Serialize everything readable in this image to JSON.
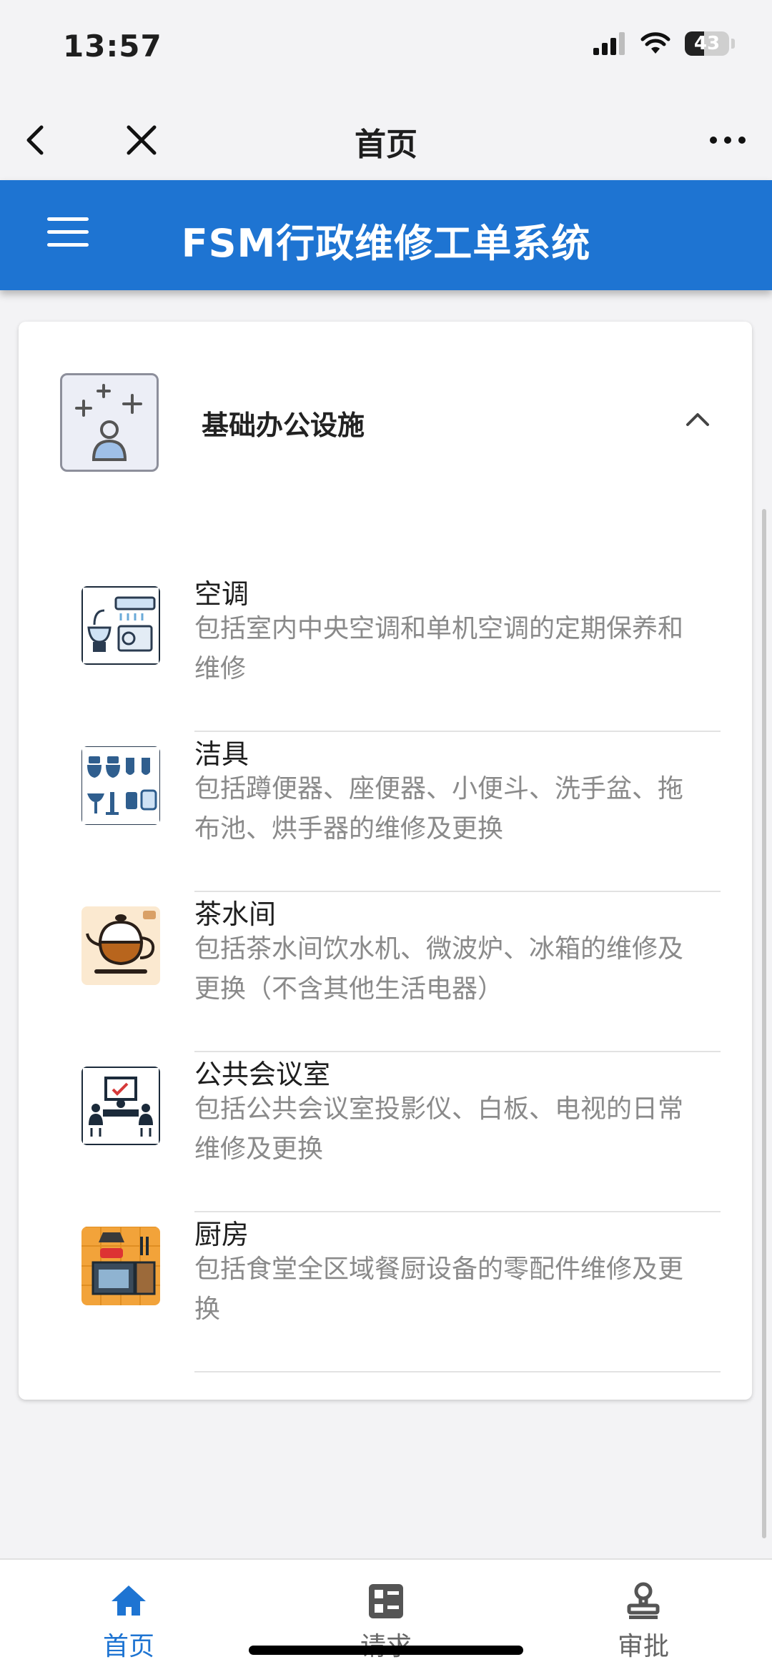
{
  "status_bar": {
    "time": "13:57",
    "battery": "43",
    "battery_level": 0.43
  },
  "nav": {
    "title": "首页"
  },
  "app": {
    "title": "FSM行政维修工单系统"
  },
  "category": {
    "title": "基础办公设施",
    "items": [
      {
        "name": "空调",
        "desc": "包括室内中央空调和单机空调的定期保养和维修",
        "icon": "air-conditioner-icon"
      },
      {
        "name": "洁具",
        "desc": "包括蹲便器、座便器、小便斗、洗手盆、拖布池、烘手器的维修及更换",
        "icon": "sanitary-ware-icon"
      },
      {
        "name": "茶水间",
        "desc": "包括茶水间饮水机、微波炉、冰箱的维修及更换（不含其他生活电器）",
        "icon": "teapot-icon"
      },
      {
        "name": "公共会议室",
        "desc": "包括公共会议室投影仪、白板、电视的日常维修及更换",
        "icon": "meeting-room-icon"
      },
      {
        "name": "厨房",
        "desc": "包括食堂全区域餐厨设备的零配件维修及更换",
        "icon": "kitchen-icon"
      }
    ]
  },
  "tabs": [
    {
      "label": "首页",
      "icon": "home-icon",
      "active": true
    },
    {
      "label": "请求",
      "icon": "request-list-icon",
      "active": false
    },
    {
      "label": "审批",
      "icon": "approval-stamp-icon",
      "active": false
    }
  ],
  "colors": {
    "primary": "#1e74d2",
    "background": "#f3f3f5",
    "desc_text": "#8a8a8a"
  }
}
